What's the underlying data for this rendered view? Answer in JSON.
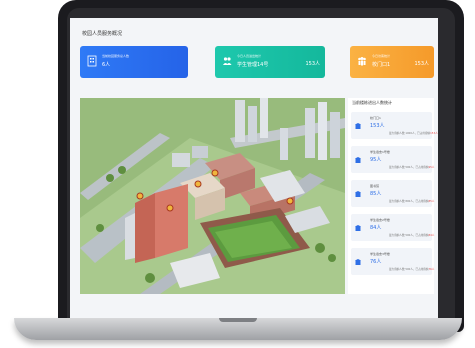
{
  "page_title": "校园人员服务概况",
  "cards": [
    {
      "label": "当前校园服务总人数",
      "value": "6人",
      "number": "",
      "color": "#2f7af6",
      "icon": "building-people-icon"
    },
    {
      "label": "今日人员进出统计",
      "value": "学生管理14号",
      "number": "153人",
      "color": "#1ec8ad",
      "icon": "people-flow-icon"
    },
    {
      "label": "今日访客统计",
      "value": "校门口1",
      "number": "153人",
      "color": "#fbb243",
      "icon": "visitor-group-icon"
    }
  ],
  "panel": {
    "title": "当前楼栋进出人数统计",
    "items": [
      {
        "name": "校门口1",
        "value": "153人",
        "note_prefix": "最大容纳人数 1000人，已占用容纳",
        "note_value": "153人"
      },
      {
        "name": "学生宿舍1号楼",
        "value": "95人",
        "note_prefix": "最大容纳人数 500人，已占用容纳",
        "note_value": "95人"
      },
      {
        "name": "图书馆",
        "value": "85人",
        "note_prefix": "最大容纳人数 800人，已占用容纳",
        "note_value": "85人"
      },
      {
        "name": "学生宿舍2号楼",
        "value": "84人",
        "note_prefix": "最大容纳人数 500人，已占用容纳",
        "note_value": "84人"
      },
      {
        "name": "学生宿舍3号楼",
        "value": "76人",
        "note_prefix": "最大容纳人数 500人，已占用容纳",
        "note_value": "76人"
      }
    ]
  },
  "colors": {
    "accent": "#2f6fe6",
    "warning": "#e84a4a"
  }
}
